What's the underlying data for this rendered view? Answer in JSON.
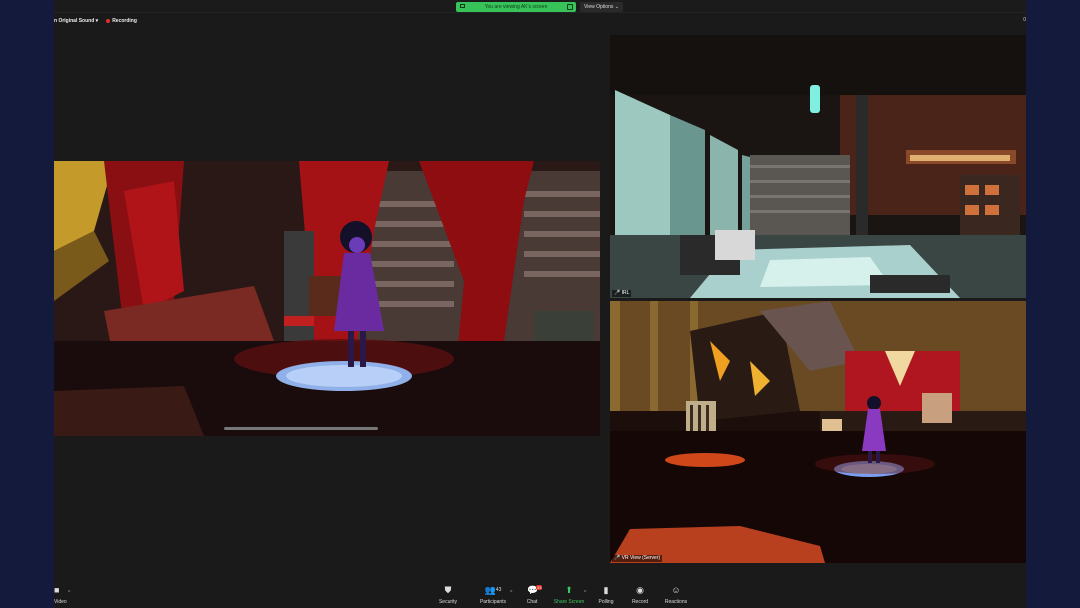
{
  "share_banner": {
    "text": "You are viewing AK's screen"
  },
  "view_options": {
    "label": "View Options ⌄"
  },
  "status": {
    "sound": "n Original Sound",
    "sound_caret": "▾",
    "recording": "Recording",
    "corner": "0"
  },
  "tiles": {
    "irl_label": "IRL",
    "vr_label": "VR View (Server)"
  },
  "toolbar": {
    "video": "Video",
    "security": "Security",
    "participants": "Participants",
    "participants_count": "43",
    "chat": "Chat",
    "chat_badge": "33",
    "share_screen": "Share Screen",
    "polling": "Polling",
    "record": "Record",
    "reactions": "Reactions"
  },
  "icons": [
    "video-icon",
    "shield-icon",
    "participants-icon",
    "chat-icon",
    "share-screen-icon",
    "polling-icon",
    "record-icon",
    "reactions-icon"
  ],
  "colors": {
    "share_green": "#37c35a",
    "record_red": "#e0322b",
    "accent_green": "#3fc75f"
  }
}
